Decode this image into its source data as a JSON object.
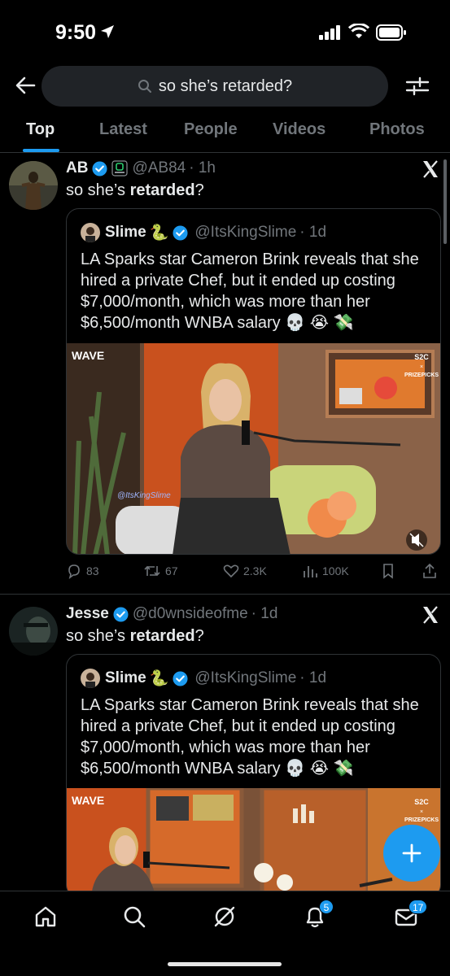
{
  "status_bar": {
    "time": "9:50"
  },
  "search": {
    "query": "so she’s retarded?"
  },
  "tabs": [
    {
      "label": "Top",
      "active": true
    },
    {
      "label": "Latest",
      "active": false
    },
    {
      "label": "People",
      "active": false
    },
    {
      "label": "Videos",
      "active": false
    },
    {
      "label": "Photos",
      "active": false
    }
  ],
  "tweets": [
    {
      "name": "AB",
      "handle": "@AB84",
      "time": "· 1h",
      "text_pre": "so she’s ",
      "text_bold": "retarded",
      "text_post": "?",
      "quote": {
        "name": "Slime",
        "emoji": "🐍",
        "handle": "@ItsKingSlime",
        "time": "· 1d",
        "text": "LA Sparks star Cameron Brink reveals that she hired a private Chef, but it ended up costing $7,000/month, which was more than her $6,500/month WNBA salary 💀 😭 💸",
        "media": {
          "brand": "WAVE",
          "partner_top": "S2C",
          "partner_x": "×",
          "partner_bottom": "PRIZEPICKS",
          "watermark": "@ItsKingSlime"
        }
      },
      "stats": {
        "replies": "83",
        "reposts": "67",
        "likes": "2.3K",
        "views": "100K"
      }
    },
    {
      "name": "Jesse",
      "handle": "@d0wnsideofme",
      "time": "· 1d",
      "text_pre": "so she’s ",
      "text_bold": "retarded",
      "text_post": "?",
      "quote": {
        "name": "Slime",
        "emoji": "🐍",
        "handle": "@ItsKingSlime",
        "time": "· 1d",
        "text": "LA Sparks star Cameron Brink reveals that she hired a private Chef, but it ended up costing $7,000/month, which was more than her $6,500/month WNBA salary 💀 😭 💸",
        "media": {
          "brand": "WAVE",
          "partner_top": "S2C",
          "partner_x": "×",
          "partner_bottom": "PRIZEPICKS"
        }
      }
    }
  ],
  "nav": {
    "items": [
      "home-icon",
      "search-icon",
      "grok-icon",
      "notifications-icon",
      "messages-icon"
    ],
    "notifications_badge": "5",
    "messages_badge": "17"
  },
  "colors": {
    "accent": "#1d9bf0",
    "background": "#000000",
    "muted": "#71767b",
    "divider": "#2f3336"
  }
}
